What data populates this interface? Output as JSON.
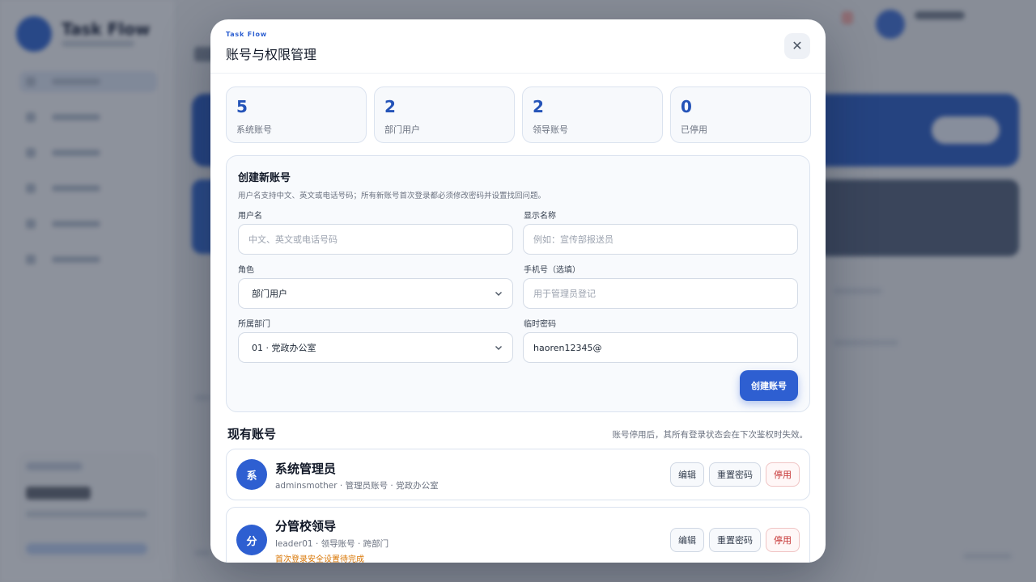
{
  "modal": {
    "brand": "Task Flow",
    "title": "账号与权限管理",
    "close_symbol": "✕"
  },
  "stats": [
    {
      "value": "5",
      "label": "系统账号"
    },
    {
      "value": "2",
      "label": "部门用户"
    },
    {
      "value": "2",
      "label": "领导账号"
    },
    {
      "value": "0",
      "label": "已停用"
    }
  ],
  "create_form": {
    "title": "创建新账号",
    "description": "用户名支持中文、英文或电话号码；所有新账号首次登录都必须修改密码并设置找回问题。",
    "username": {
      "label": "用户名",
      "placeholder": "中文、英文或电话号码",
      "value": ""
    },
    "display_name": {
      "label": "显示名称",
      "placeholder": "例如：宣传部报送员",
      "value": ""
    },
    "role": {
      "label": "角色",
      "selected": "部门用户"
    },
    "phone": {
      "label": "手机号（选填）",
      "placeholder": "用于管理员登记",
      "value": ""
    },
    "department": {
      "label": "所属部门",
      "selected": "01 · 党政办公室"
    },
    "temp_password": {
      "label": "临时密码",
      "value": "haoren12345@"
    },
    "submit_label": "创建账号"
  },
  "accounts_section": {
    "title": "现有账号",
    "note": "账号停用后，其所有登录状态会在下次鉴权时失效。",
    "items": [
      {
        "avatar": "系",
        "name": "系统管理员",
        "meta": "adminsmother · 管理员账号 · 党政办公室",
        "warning": "",
        "edit_label": "编辑",
        "reset_label": "重置密码",
        "disable_label": "停用"
      },
      {
        "avatar": "分",
        "name": "分管校领导",
        "meta": "leader01 · 领导账号 · 跨部门",
        "warning": "首次登录安全设置待完成",
        "edit_label": "编辑",
        "reset_label": "重置密码",
        "disable_label": "停用"
      }
    ]
  },
  "colors": {
    "accent": "#2e5fd1",
    "danger": "#c53030",
    "warning": "#d97706",
    "overlay": "#111827"
  },
  "icons": {
    "close": "close-icon",
    "dropdown": "chevron-down-icon"
  }
}
